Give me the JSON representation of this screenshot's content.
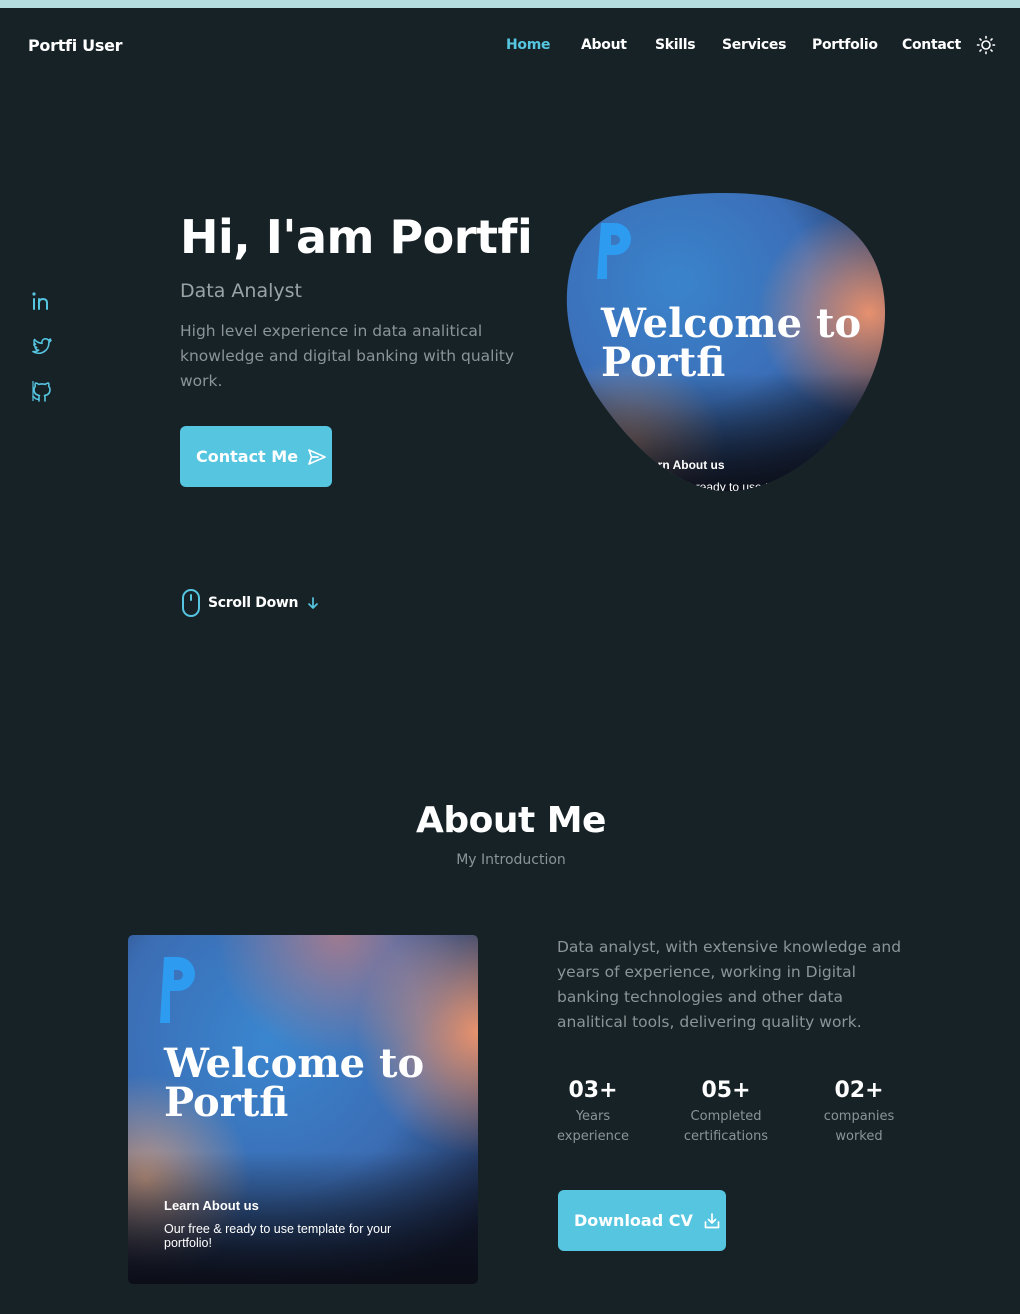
{
  "brand": "Portfi User",
  "nav": {
    "items": [
      {
        "label": "Home",
        "active": true
      },
      {
        "label": "About",
        "active": false
      },
      {
        "label": "Skills",
        "active": false
      },
      {
        "label": "Services",
        "active": false
      },
      {
        "label": "Portfolio",
        "active": false
      },
      {
        "label": "Contact",
        "active": false
      }
    ],
    "theme_icon": "sun-icon"
  },
  "social": [
    "linkedin-icon",
    "twitter-icon",
    "github-icon"
  ],
  "hero": {
    "title": "Hi, I'am Portfi",
    "subtitle": "Data Analyst",
    "description": "High level experience in data analitical knowledge and digital banking with quality work.",
    "contact_button": "Contact Me",
    "scroll_label": "Scroll Down",
    "image": {
      "logo_letter": "P",
      "heading_line1": "Welcome to",
      "heading_line2": "Portfi",
      "caption_title": "Learn About us",
      "caption_text": "Our free & ready to use template for your portfolio!"
    }
  },
  "about": {
    "title": "About Me",
    "subtitle": "My Introduction",
    "description": "Data analyst, with extensive knowledge and years of experience, working in Digital banking technologies and other data analitical tools, delivering quality work.",
    "stats": [
      {
        "value": "03+",
        "label_line1": "Years",
        "label_line2": "experience"
      },
      {
        "value": "05+",
        "label_line1": "Completed",
        "label_line2": "certifications"
      },
      {
        "value": "02+",
        "label_line1": "companies",
        "label_line2": "worked"
      }
    ],
    "download_button": "Download CV"
  },
  "colors": {
    "background": "#172227",
    "accent": "#55c5e0",
    "muted_text": "#8b9497"
  }
}
